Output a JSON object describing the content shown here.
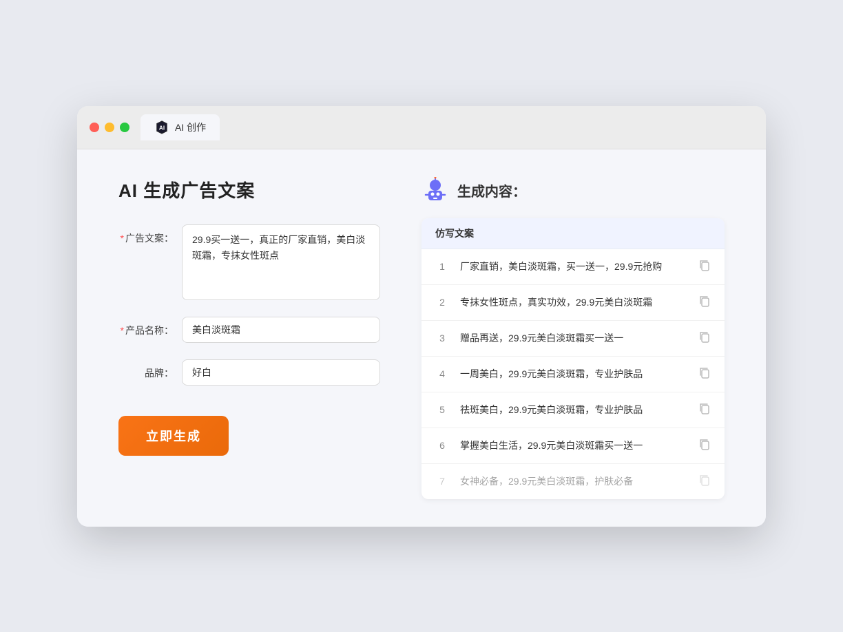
{
  "browser": {
    "tab_label": "AI 创作",
    "traffic_lights": [
      "red",
      "yellow",
      "green"
    ]
  },
  "left_panel": {
    "title": "AI 生成广告文案",
    "form": {
      "ad_copy_label": "广告文案：",
      "ad_copy_required": "*",
      "ad_copy_value": "29.9买一送一，真正的厂家直销，美白淡斑霜，专抹女性斑点",
      "product_name_label": "产品名称：",
      "product_name_required": "*",
      "product_name_value": "美白淡斑霜",
      "brand_label": "品牌：",
      "brand_value": "好白"
    },
    "generate_btn": "立即生成"
  },
  "right_panel": {
    "title": "生成内容：",
    "table_header": "仿写文案",
    "rows": [
      {
        "num": "1",
        "text": "厂家直销，美白淡斑霜，买一送一，29.9元抢购",
        "dimmed": false
      },
      {
        "num": "2",
        "text": "专抹女性斑点，真实功效，29.9元美白淡斑霜",
        "dimmed": false
      },
      {
        "num": "3",
        "text": "赠品再送，29.9元美白淡斑霜买一送一",
        "dimmed": false
      },
      {
        "num": "4",
        "text": "一周美白，29.9元美白淡斑霜，专业护肤品",
        "dimmed": false
      },
      {
        "num": "5",
        "text": "祛斑美白，29.9元美白淡斑霜，专业护肤品",
        "dimmed": false
      },
      {
        "num": "6",
        "text": "掌握美白生活，29.9元美白淡斑霜买一送一",
        "dimmed": false
      },
      {
        "num": "7",
        "text": "女神必备，29.9元美白淡斑霜，护肤必备",
        "dimmed": true
      }
    ]
  }
}
